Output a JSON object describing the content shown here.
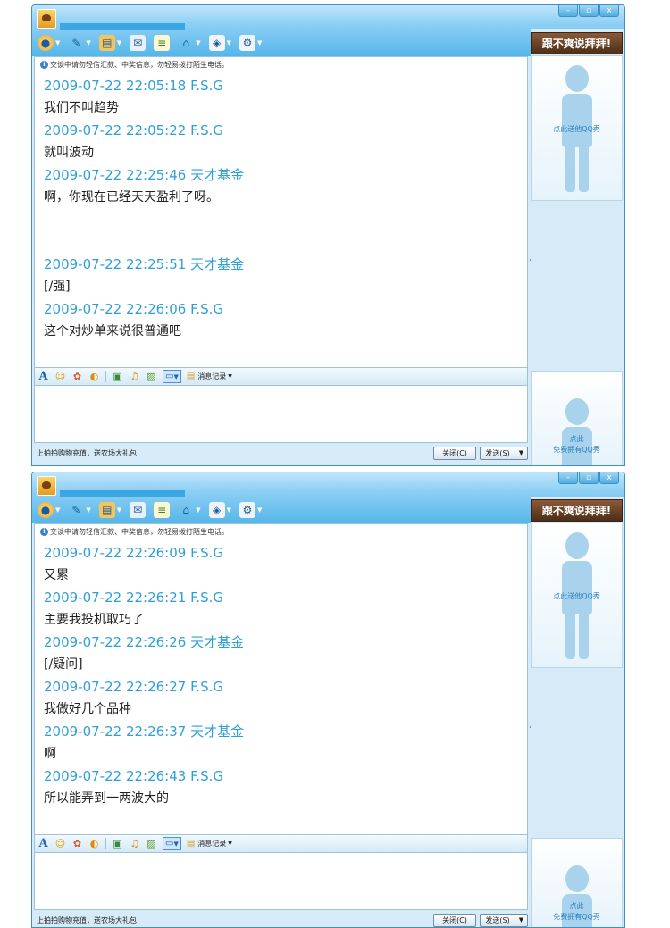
{
  "notice": "交谈中请勿轻信汇款、中奖信息，勿轻易拨打陌生电话。",
  "window_controls": {
    "minimize": "–",
    "maximize": "▫",
    "close": "x"
  },
  "toolbar_icons": [
    "video-call-icon",
    "voice-call-icon",
    "send-file-icon",
    "screenshot-icon",
    "chat-app-icon",
    "remote-assist-icon",
    "app-box-icon",
    "settings-icon"
  ],
  "banner": "跟不爽说拜拜!",
  "qq_show_label": "点此送他QQ秀",
  "qq_show_small_label_1": "点此",
  "qq_show_small_label_2": "免费拥有QQ秀",
  "history_label": "消息记录",
  "promo": "上拍拍购物充值，送农场大礼包",
  "close_button": "关闭(C)",
  "send_button": "发送(S)",
  "windows": [
    {
      "messages": [
        {
          "header": "2009-07-22 22:05:18 F.S.G",
          "text": "我们不叫趋势"
        },
        {
          "header": "2009-07-22 22:05:22 F.S.G",
          "text": "就叫波动"
        },
        {
          "header": "2009-07-22 22:25:46 天才基金",
          "text": "啊，你现在已经天天盈利了呀。"
        },
        {
          "header": "2009-07-22 22:25:51 天才基金",
          "text": "[/强]"
        },
        {
          "header": "2009-07-22 22:26:06 F.S.G",
          "text": "这个对炒单来说很普通吧"
        }
      ]
    },
    {
      "messages": [
        {
          "header": "2009-07-22 22:26:09 F.S.G",
          "text": "又累"
        },
        {
          "header": "2009-07-22 22:26:21 F.S.G",
          "text": "主要我投机取巧了"
        },
        {
          "header": "2009-07-22 22:26:26 天才基金",
          "text": "[/疑问]"
        },
        {
          "header": "2009-07-22 22:26:27 F.S.G",
          "text": "我做好几个品种"
        },
        {
          "header": "2009-07-22 22:26:37 天才基金",
          "text": "啊"
        },
        {
          "header": "2009-07-22 22:26:43 F.S.G",
          "text": "所以能弄到一两波大的"
        }
      ]
    }
  ]
}
